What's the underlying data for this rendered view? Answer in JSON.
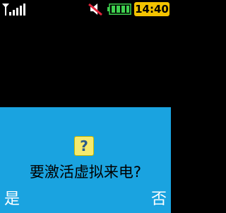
{
  "status_bar": {
    "signal_icon": "signal-strength-icon",
    "mute_icon": "muted-speaker-icon",
    "battery_icon": "battery-icon",
    "time": "14:40",
    "colors": {
      "signal": "#ffffff",
      "mute_speaker": "#ffffff",
      "mute_slash": "#e0243a",
      "battery": "#3fd04f",
      "clock_background": "#f3c300"
    }
  },
  "dialog": {
    "icon": "question-icon",
    "icon_glyph": "?",
    "message": "要激活虚拟来电?",
    "background": "#1aa3e0"
  },
  "softkeys": {
    "left_label": "是",
    "right_label": "否"
  }
}
